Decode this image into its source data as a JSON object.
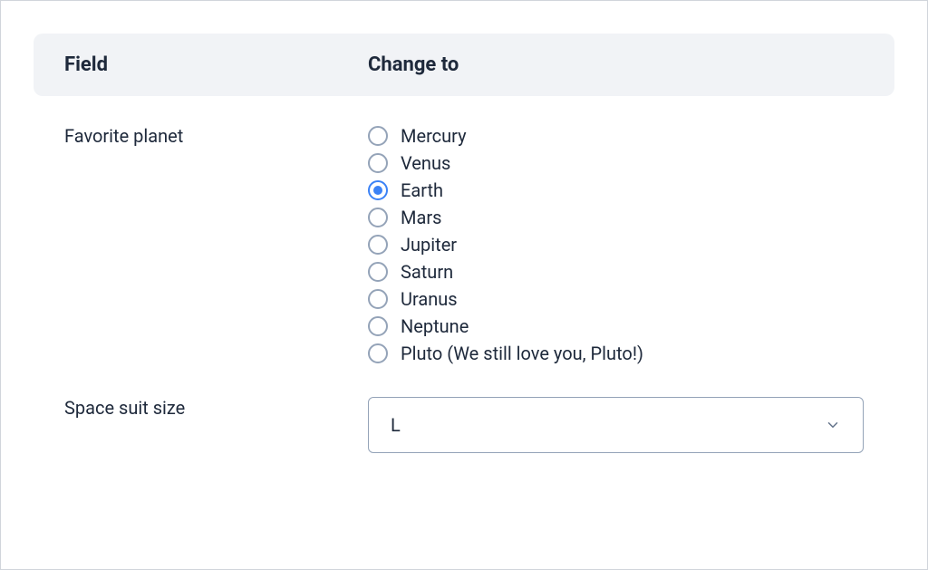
{
  "header": {
    "field": "Field",
    "change_to": "Change to"
  },
  "rows": {
    "favorite_planet": {
      "label": "Favorite planet",
      "options": [
        {
          "label": "Mercury",
          "selected": false
        },
        {
          "label": "Venus",
          "selected": false
        },
        {
          "label": "Earth",
          "selected": true
        },
        {
          "label": "Mars",
          "selected": false
        },
        {
          "label": "Jupiter",
          "selected": false
        },
        {
          "label": "Saturn",
          "selected": false
        },
        {
          "label": "Uranus",
          "selected": false
        },
        {
          "label": "Neptune",
          "selected": false
        },
        {
          "label": "Pluto (We still love you, Pluto!)",
          "selected": false
        }
      ]
    },
    "space_suit_size": {
      "label": "Space suit size",
      "value": "L"
    }
  }
}
